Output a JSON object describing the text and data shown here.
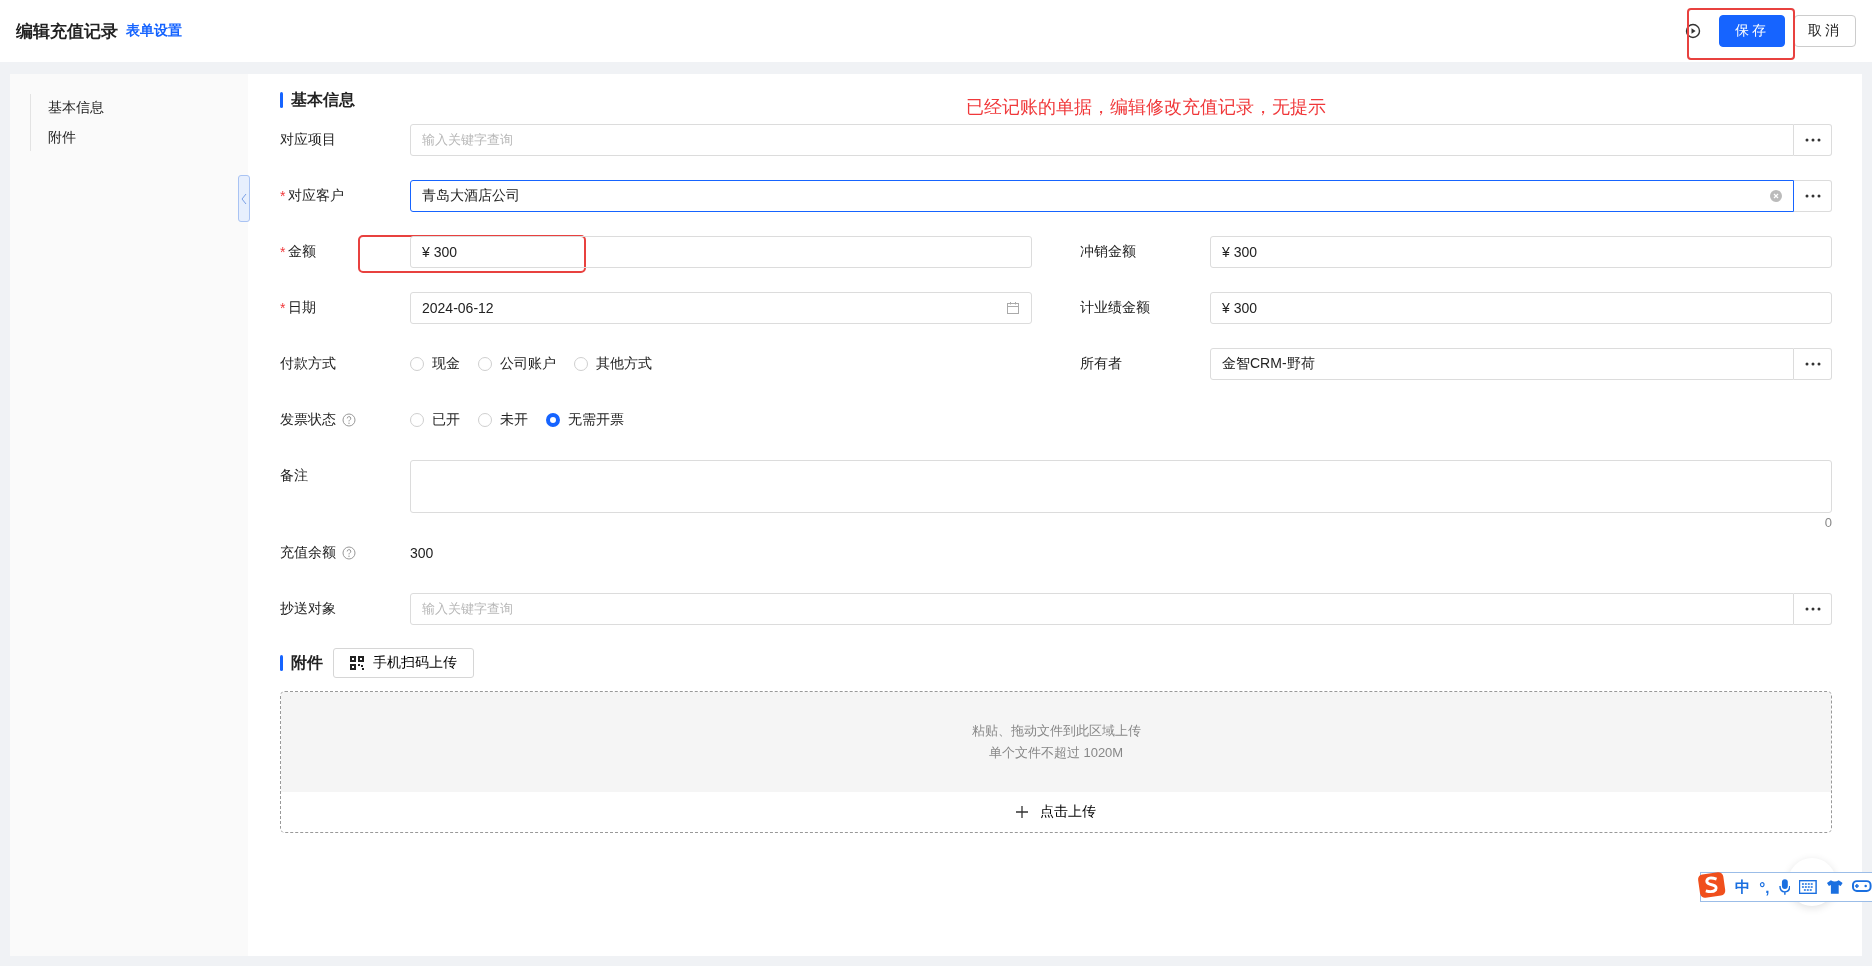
{
  "header": {
    "title": "编辑充值记录",
    "link": "表单设置",
    "buttons": [
      {
        "label": "保存",
        "kind": "primary"
      },
      {
        "label": "取消",
        "kind": "default"
      }
    ]
  },
  "sidebar": {
    "items": [
      {
        "label": "基本信息"
      },
      {
        "label": "附件"
      }
    ]
  },
  "annotation": "已经记账的单据，编辑修改充值记录，无提示",
  "basic": {
    "title": "基本信息",
    "rows": [
      {
        "fields": [
          {
            "label": "对应项目",
            "kind": "lookup",
            "placeholder": "输入关键字查询"
          }
        ]
      },
      {
        "fields": [
          {
            "required_mark": "*",
            "label": "对应客户",
            "kind": "lookup",
            "value": "青岛大酒店公司",
            "focused": true,
            "clearable": true
          }
        ]
      },
      {
        "fields": [
          {
            "required_mark": "*",
            "label": "金额",
            "kind": "text",
            "value": "¥ 300",
            "highlighted": true
          },
          {
            "label": "冲销金额",
            "kind": "text",
            "value": "¥ 300"
          }
        ]
      },
      {
        "fields": [
          {
            "required_mark": "*",
            "label": "日期",
            "kind": "date",
            "value": "2024-06-12"
          },
          {
            "label": "计业绩金额",
            "kind": "text",
            "value": "¥ 300"
          }
        ]
      },
      {
        "fields": [
          {
            "label": "付款方式",
            "kind": "radio",
            "options": [
              {
                "label": "现金",
                "selected": false
              },
              {
                "label": "公司账户",
                "selected": false
              },
              {
                "label": "其他方式",
                "selected": false
              }
            ]
          },
          {
            "label": "所有者",
            "kind": "lookup",
            "value": "金智CRM-野荷"
          }
        ]
      },
      {
        "fields": [
          {
            "label": "发票状态",
            "help": true,
            "kind": "radio",
            "options": [
              {
                "label": "已开",
                "selected": false
              },
              {
                "label": "未开",
                "selected": false
              },
              {
                "label": "无需开票",
                "selected": true
              }
            ]
          }
        ]
      },
      {
        "fields": [
          {
            "label": "备注",
            "kind": "textarea",
            "counter": "0"
          }
        ]
      },
      {
        "fields": [
          {
            "label": "充值余额",
            "help": true,
            "kind": "readonly",
            "value": "300"
          }
        ]
      },
      {
        "fields": [
          {
            "label": "抄送对象",
            "kind": "lookup",
            "placeholder": "输入关键字查询"
          }
        ]
      }
    ]
  },
  "attachments": {
    "title": "附件",
    "scan_button": "手机扫码上传",
    "hint_lines": [
      "粘贴、拖动文件到此区域上传",
      "单个文件不超过 1020M"
    ],
    "upload_button": "点击上传"
  },
  "ime": {
    "mode": "中",
    "punctuation": "°,"
  }
}
